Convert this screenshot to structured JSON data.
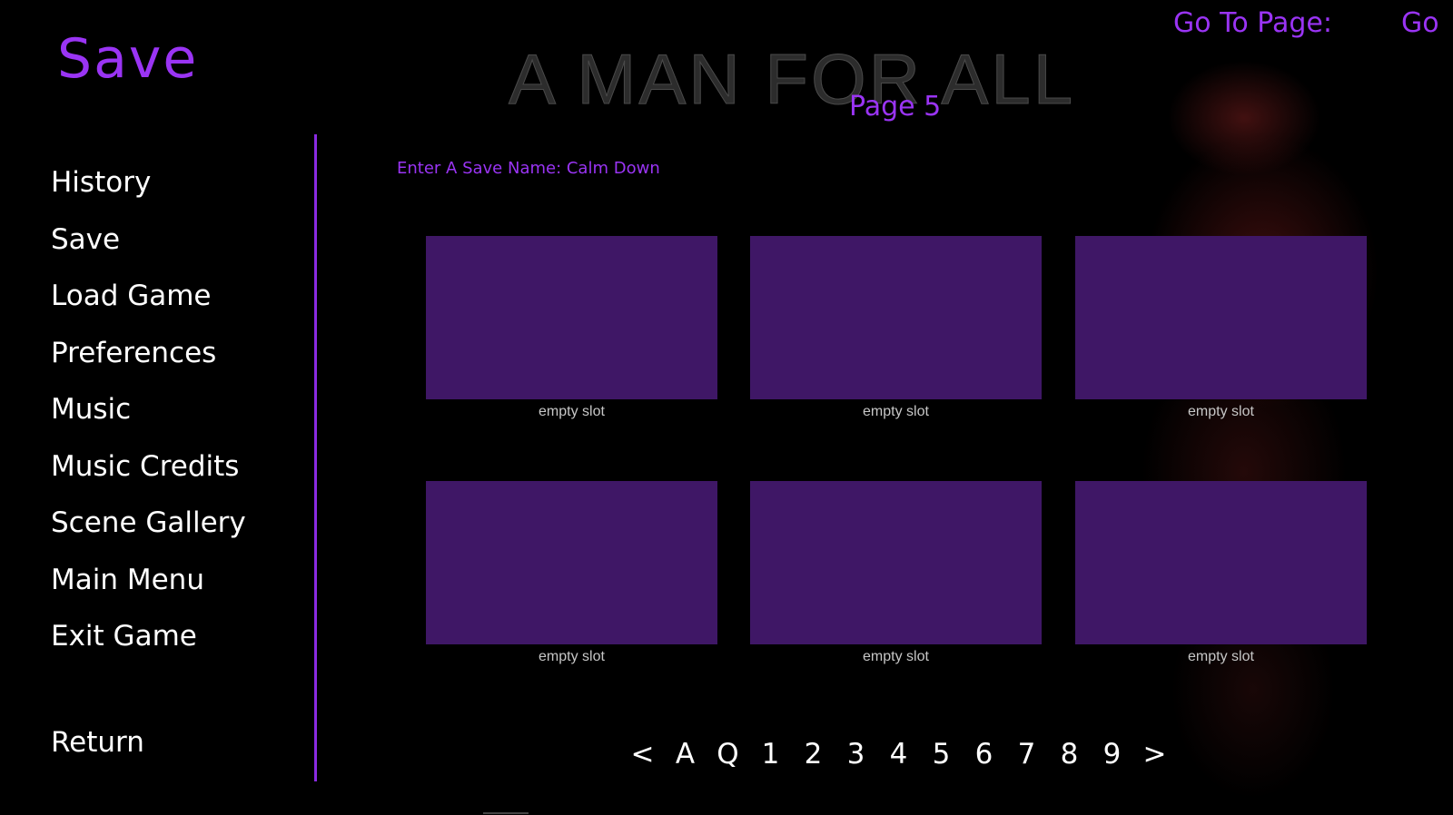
{
  "screen": {
    "title": "Save",
    "game_logo": "A MAN FOR ALL",
    "page_label": "Page 5",
    "goto": {
      "label": "Go To Page:",
      "button": "Go"
    },
    "save_name_prompt": "Enter A Save Name: Calm Down"
  },
  "nav": {
    "items": [
      {
        "label": "History"
      },
      {
        "label": "Save"
      },
      {
        "label": "Load Game"
      },
      {
        "label": "Preferences"
      },
      {
        "label": "Music"
      },
      {
        "label": "Music Credits"
      },
      {
        "label": "Scene Gallery"
      },
      {
        "label": "Main Menu"
      },
      {
        "label": "Exit Game"
      }
    ],
    "return_label": "Return"
  },
  "slots": [
    {
      "label": "empty slot"
    },
    {
      "label": "empty slot"
    },
    {
      "label": "empty slot"
    },
    {
      "label": "empty slot"
    },
    {
      "label": "empty slot"
    },
    {
      "label": "empty slot"
    }
  ],
  "pager": [
    "<",
    "A",
    "Q",
    "1",
    "2",
    "3",
    "4",
    "5",
    "6",
    "7",
    "8",
    "9",
    ">"
  ],
  "colors": {
    "accent": "#9a34f4",
    "slot_fill": "#3f1766",
    "divider": "#8a2be2",
    "background": "#000000"
  }
}
